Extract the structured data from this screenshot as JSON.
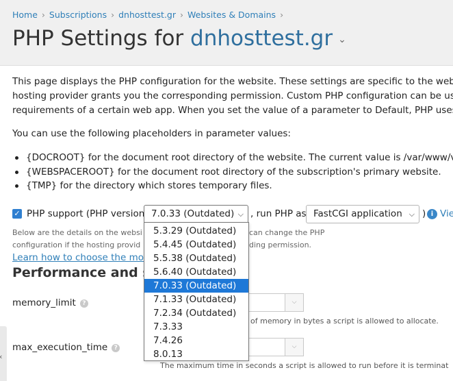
{
  "breadcrumb": [
    "Home",
    "Subscriptions",
    "dnhosttest.gr",
    "Websites & Domains"
  ],
  "title": {
    "prefix": "PHP Settings for ",
    "domain": "dnhosttest.gr"
  },
  "description": [
    "This page displays the PHP configuration for the website. These settings are specific to the website",
    "hosting provider grants you the corresponding permission. Custom PHP configuration can be used,",
    "requirements of a certain web app. When you set the value of a parameter to Default, PHP uses the"
  ],
  "placeholders_intro": "You can use the following placeholders in parameter values:",
  "placeholders": [
    "{DOCROOT} for the document root directory of the website. The current value is /var/www/vhos",
    "{WEBSPACEROOT} for the document root directory of the subscription's primary website.",
    "{TMP} for the directory which stores temporary files."
  ],
  "php_support": {
    "checked": true,
    "label": "PHP support (PHP version",
    "version_selected": "7.0.33 (Outdated)",
    "run_label": ", run PHP as",
    "handler_selected": "FastCGI application",
    "paren": ")",
    "view_link": "Vie"
  },
  "note_lines": [
    "Below are the details on the websi",
    "can change the PHP",
    "configuration if the hosting provid",
    "ding permission."
  ],
  "learn_link": "Learn how to choose the mos",
  "section_title": "Performance and se",
  "params": [
    {
      "name": "memory_limit",
      "hint": "of memory in bytes a script is allowed to allocate."
    },
    {
      "name": "max_execution_time",
      "hint": "The maximum time in seconds a script is allowed to run before it is terminat"
    }
  ],
  "side_tab_glyph": "‹",
  "version_options": [
    "5.3.29 (Outdated)",
    "5.4.45 (Outdated)",
    "5.5.38 (Outdated)",
    "5.6.40 (Outdated)",
    "7.0.33 (Outdated)",
    "7.1.33 (Outdated)",
    "7.2.34 (Outdated)",
    "7.3.33",
    "7.4.26",
    "8.0.13"
  ],
  "version_selected_index": 4,
  "colors": {
    "accent": "#1e78d7",
    "link": "#2f7fb8",
    "title_domain": "#2f6f9e"
  }
}
